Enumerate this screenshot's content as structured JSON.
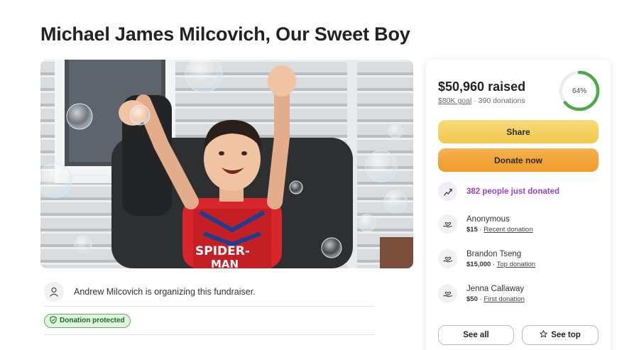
{
  "page": {
    "title": "Michael James Milcovich, Our Sweet Boy"
  },
  "hero": {
    "shirt_text_1": "SPIDER-",
    "shirt_text_2": "MAN"
  },
  "organizer": {
    "icon": "person-icon",
    "text": "Andrew Milcovich is organizing this fundraiser."
  },
  "protection": {
    "icon": "shield-icon",
    "label": "Donation protected",
    "color": "#63b263"
  },
  "card": {
    "raised": "$50,960 raised",
    "goal": "$80K goal",
    "separator": "·",
    "donations": "390 donations",
    "progress_label": "64%",
    "progress": 0.64,
    "progress_color": "#4caa4c",
    "share_label": "Share",
    "donate_label": "Donate now",
    "trend_icon": "trending-up-icon",
    "trend_text": "382 people just donated",
    "trend_color": "#9a3fd0",
    "donors": [
      {
        "name": "Anonymous",
        "amount": "$15",
        "tag": "Recent donation"
      },
      {
        "name": "Brandon Tseng",
        "amount": "$15,000",
        "tag": "Top donation"
      },
      {
        "name": "Jenna Callaway",
        "amount": "$50",
        "tag": "First donation"
      }
    ],
    "see_all_label": "See all",
    "see_top_label": "See top",
    "see_top_icon": "star-icon"
  }
}
